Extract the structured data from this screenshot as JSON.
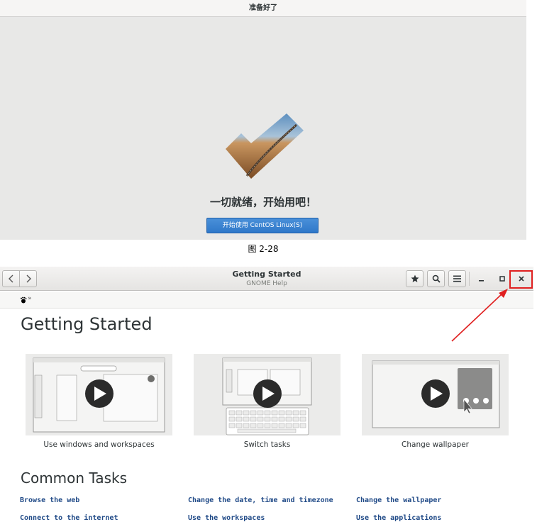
{
  "setup": {
    "header_title": "准备好了",
    "heading": "一切就绪，开始用吧！",
    "start_button": "开始使用 CentOS Linux(S)"
  },
  "caption": "图 2-28",
  "help_window": {
    "title": "Getting Started",
    "subtitle": "GNOME Help",
    "breadcrumb_separator": "»",
    "page_title": "Getting Started",
    "cards": [
      {
        "caption": "Use windows and workspaces"
      },
      {
        "caption": "Switch tasks"
      },
      {
        "caption": "Change wallpaper"
      }
    ],
    "section_title": "Common Tasks",
    "tasks_row1": [
      "Browse the web",
      "Change the date, time and timezone",
      "Change the wallpaper"
    ],
    "tasks_row2_partial": [
      "Connect to the internet",
      "Use the workspaces",
      "Use the applications"
    ],
    "icons": {
      "back": "chevron-left-icon",
      "forward": "chevron-right-icon",
      "bookmark": "star-icon",
      "search": "search-icon",
      "menu": "hamburger-menu-icon",
      "minimize": "minimize-icon",
      "maximize": "maximize-icon",
      "close": "close-icon"
    }
  },
  "colors": {
    "accent_button": "#2f78c9",
    "link": "#204a87",
    "annotation": "#e02020"
  }
}
